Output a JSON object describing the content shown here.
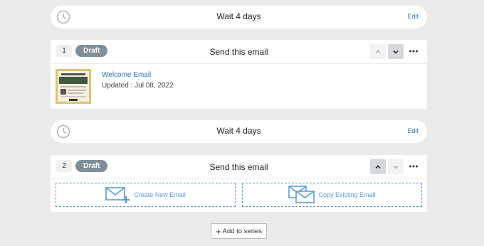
{
  "steps": [
    {
      "type": "wait",
      "text": "Wait 4 days",
      "edit_label": "Edit"
    },
    {
      "type": "email",
      "number": "1",
      "status": "Draft",
      "title": "Send this email",
      "email_name": "Welcome Email",
      "updated": "Updated : Jul 08, 2022"
    },
    {
      "type": "wait",
      "text": "Wait 4 days",
      "edit_label": "Edit"
    },
    {
      "type": "email",
      "number": "2",
      "status": "Draft",
      "title": "Send this email",
      "create_label": "Create New Email",
      "copy_label": "Copy Existing Email"
    }
  ],
  "add_series_label": "Add to series",
  "colors": {
    "accent": "#2a7abf",
    "badge": "#7f8f9a",
    "dashed": "#5b9bd5"
  },
  "icons": [
    "clock-icon",
    "chevron-up-icon",
    "chevron-down-icon",
    "more-dots-icon",
    "envelope-plus-icon",
    "envelopes-copy-icon",
    "plus-icon"
  ]
}
